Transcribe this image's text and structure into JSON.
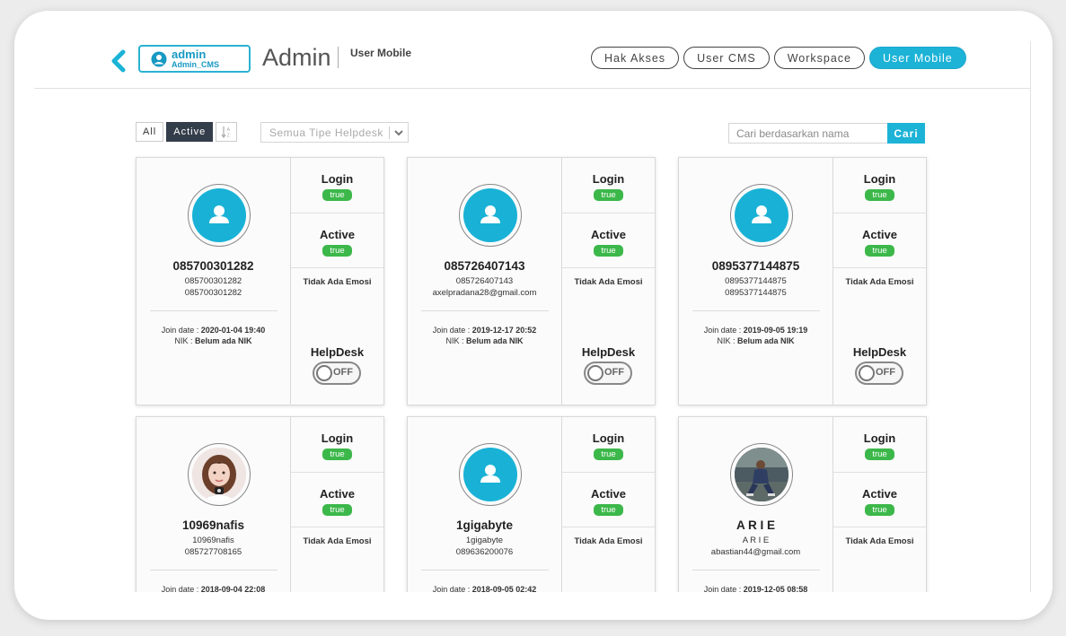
{
  "header": {
    "user_name": "admin",
    "user_role": "Admin_CMS",
    "page_title": "Admin",
    "subtitle": "User Mobile",
    "tabs": [
      {
        "label": "Hak Akses",
        "active": false
      },
      {
        "label": "User CMS",
        "active": false
      },
      {
        "label": "Workspace",
        "active": false
      },
      {
        "label": "User Mobile",
        "active": true
      }
    ]
  },
  "filters": {
    "all_label": "All",
    "active_label": "Active",
    "sort_icon": "sort-alpha-icon",
    "type_select_value": "Semua Tipe Helpdesk",
    "search_placeholder": "Cari berdasarkan nama",
    "search_button": "Cari"
  },
  "labels": {
    "login": "Login",
    "active": "Active",
    "join_date": "Join date : ",
    "nik": "NIK : ",
    "helpdesk": "HelpDesk",
    "toggle_off": "OFF"
  },
  "users": [
    {
      "name": "085700301282",
      "line1": "085700301282",
      "line2": "085700301282",
      "login": "true",
      "active": "true",
      "emosi": "Tidak Ada Emosi",
      "join_date": "2020-01-04 19:40",
      "nik": "Belum ada NIK",
      "helpdesk": "OFF",
      "avatar": "default-user-icon"
    },
    {
      "name": "085726407143",
      "line1": "085726407143",
      "line2": "axelpradana28@gmail.com",
      "login": "true",
      "active": "true",
      "emosi": "Tidak Ada Emosi",
      "join_date": "2019-12-17 20:52",
      "nik": "Belum ada NIK",
      "helpdesk": "OFF",
      "avatar": "default-user-icon"
    },
    {
      "name": "0895377144875",
      "line1": "0895377144875",
      "line2": "0895377144875",
      "login": "true",
      "active": "true",
      "emosi": "Tidak Ada Emosi",
      "join_date": "2019-09-05 19:19",
      "nik": "Belum ada NIK",
      "helpdesk": "OFF",
      "avatar": "default-user-icon"
    },
    {
      "name": "10969nafis",
      "line1": "10969nafis",
      "line2": "085727708165",
      "login": "true",
      "active": "true",
      "emosi": "Tidak Ada Emosi",
      "join_date": "2018-09-04 22:08",
      "nik": "",
      "helpdesk": "",
      "avatar": "photo-avatar-woman"
    },
    {
      "name": "1gigabyte",
      "line1": "1gigabyte",
      "line2": "089636200076",
      "login": "true",
      "active": "true",
      "emosi": "Tidak Ada Emosi",
      "join_date": "2018-09-05 02:42",
      "nik": "",
      "helpdesk": "",
      "avatar": "default-user-icon"
    },
    {
      "name": "A R I E",
      "line1": "A R I E",
      "line2": "abastian44@gmail.com",
      "login": "true",
      "active": "true",
      "emosi": "Tidak Ada Emosi",
      "join_date": "2019-12-05 08:58",
      "nik": "",
      "helpdesk": "",
      "avatar": "photo-avatar-man"
    }
  ],
  "colors": {
    "accent": "#1cb3d7",
    "badge_green": "#3cb84a",
    "dark_button": "#343d4a"
  }
}
